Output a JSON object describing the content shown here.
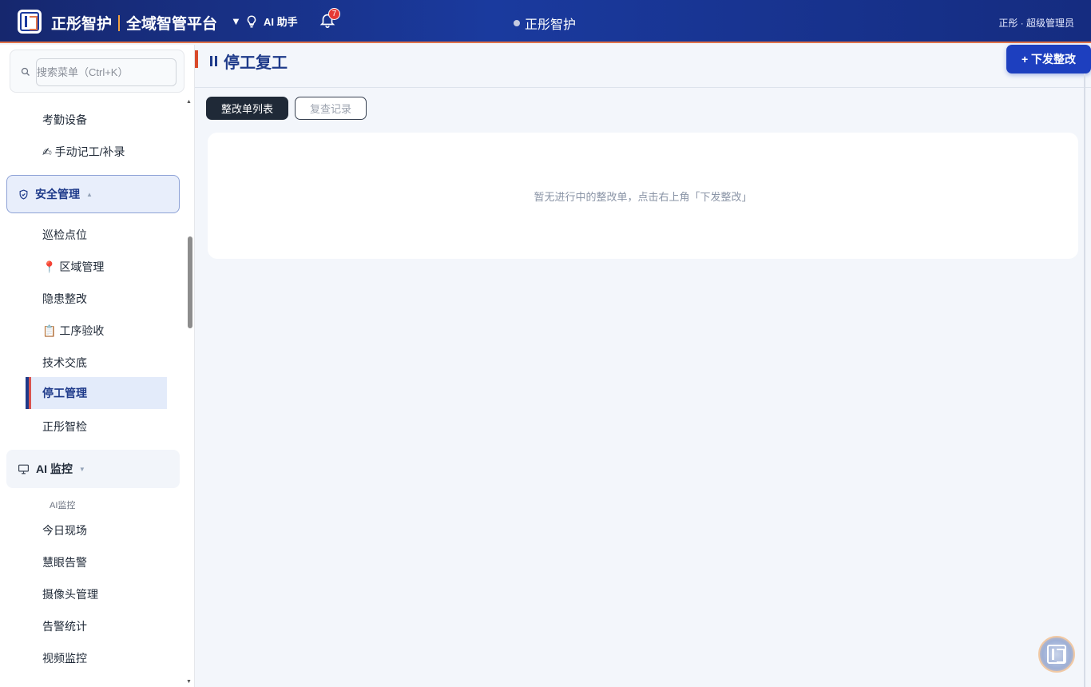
{
  "header": {
    "brand": "正彤智护",
    "platform": "全域智管平台",
    "dropdown_caret": "▼",
    "ai_assistant": "AI 助手",
    "notification_count": "7",
    "center_title": "正彤智护",
    "user": "正彤 · 超级管理员"
  },
  "sidebar": {
    "search_placeholder": "搜索菜单（Ctrl+K）",
    "items_top": [
      "考勤设备",
      "✍ 手动记工/补录"
    ],
    "safety_group": {
      "label": "安全管理",
      "caret": "▲"
    },
    "safety_items": [
      "巡检点位",
      "📍 区域管理",
      "隐患整改",
      "📋 工序验收",
      "技术交底",
      "停工管理",
      "正彤智检"
    ],
    "selected_item": "停工管理",
    "ai_group": {
      "label": "AI 监控",
      "caret": "▼"
    },
    "ai_caption": "AI监控",
    "ai_items": [
      "今日现场",
      "慧眼告警",
      "摄像头管理",
      "告警统计",
      "视频监控"
    ]
  },
  "main": {
    "title": "停工复工",
    "issue_button": "+ 下发整改",
    "tabs": [
      {
        "label": "整改单列表",
        "active": true
      },
      {
        "label": "复查记录",
        "active": false
      }
    ],
    "empty_message": "暂无进行中的整改单，点击右上角「下发整改」"
  },
  "colors": {
    "header_bg": "#1a3a9e",
    "accent": "#1d3fbf",
    "highlight": "#d94a2b"
  }
}
